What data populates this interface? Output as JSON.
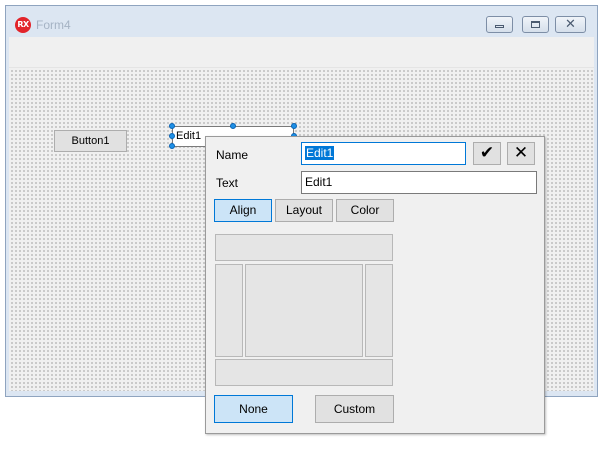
{
  "window": {
    "title": "Form4",
    "logo_text": "RX",
    "caption_buttons": {
      "minimize": "minimize-icon",
      "maximize": "maximize-icon",
      "close": "close-icon"
    }
  },
  "designer": {
    "button_label": "Button1",
    "edit_text": "Edit1"
  },
  "popup": {
    "name_label": "Name",
    "name_value": "Edit1",
    "text_label": "Text",
    "text_value": "Edit1",
    "confirm_glyph": "✔",
    "cancel_glyph": "✕",
    "tabs": [
      {
        "label": "Align",
        "active": true
      },
      {
        "label": "Layout",
        "active": false
      },
      {
        "label": "Color",
        "active": false
      }
    ],
    "none_label": "None",
    "custom_label": "Custom"
  },
  "colors": {
    "accent": "#0078d7",
    "selection_handle": "#1e90e6",
    "logo": "#e2242a"
  }
}
